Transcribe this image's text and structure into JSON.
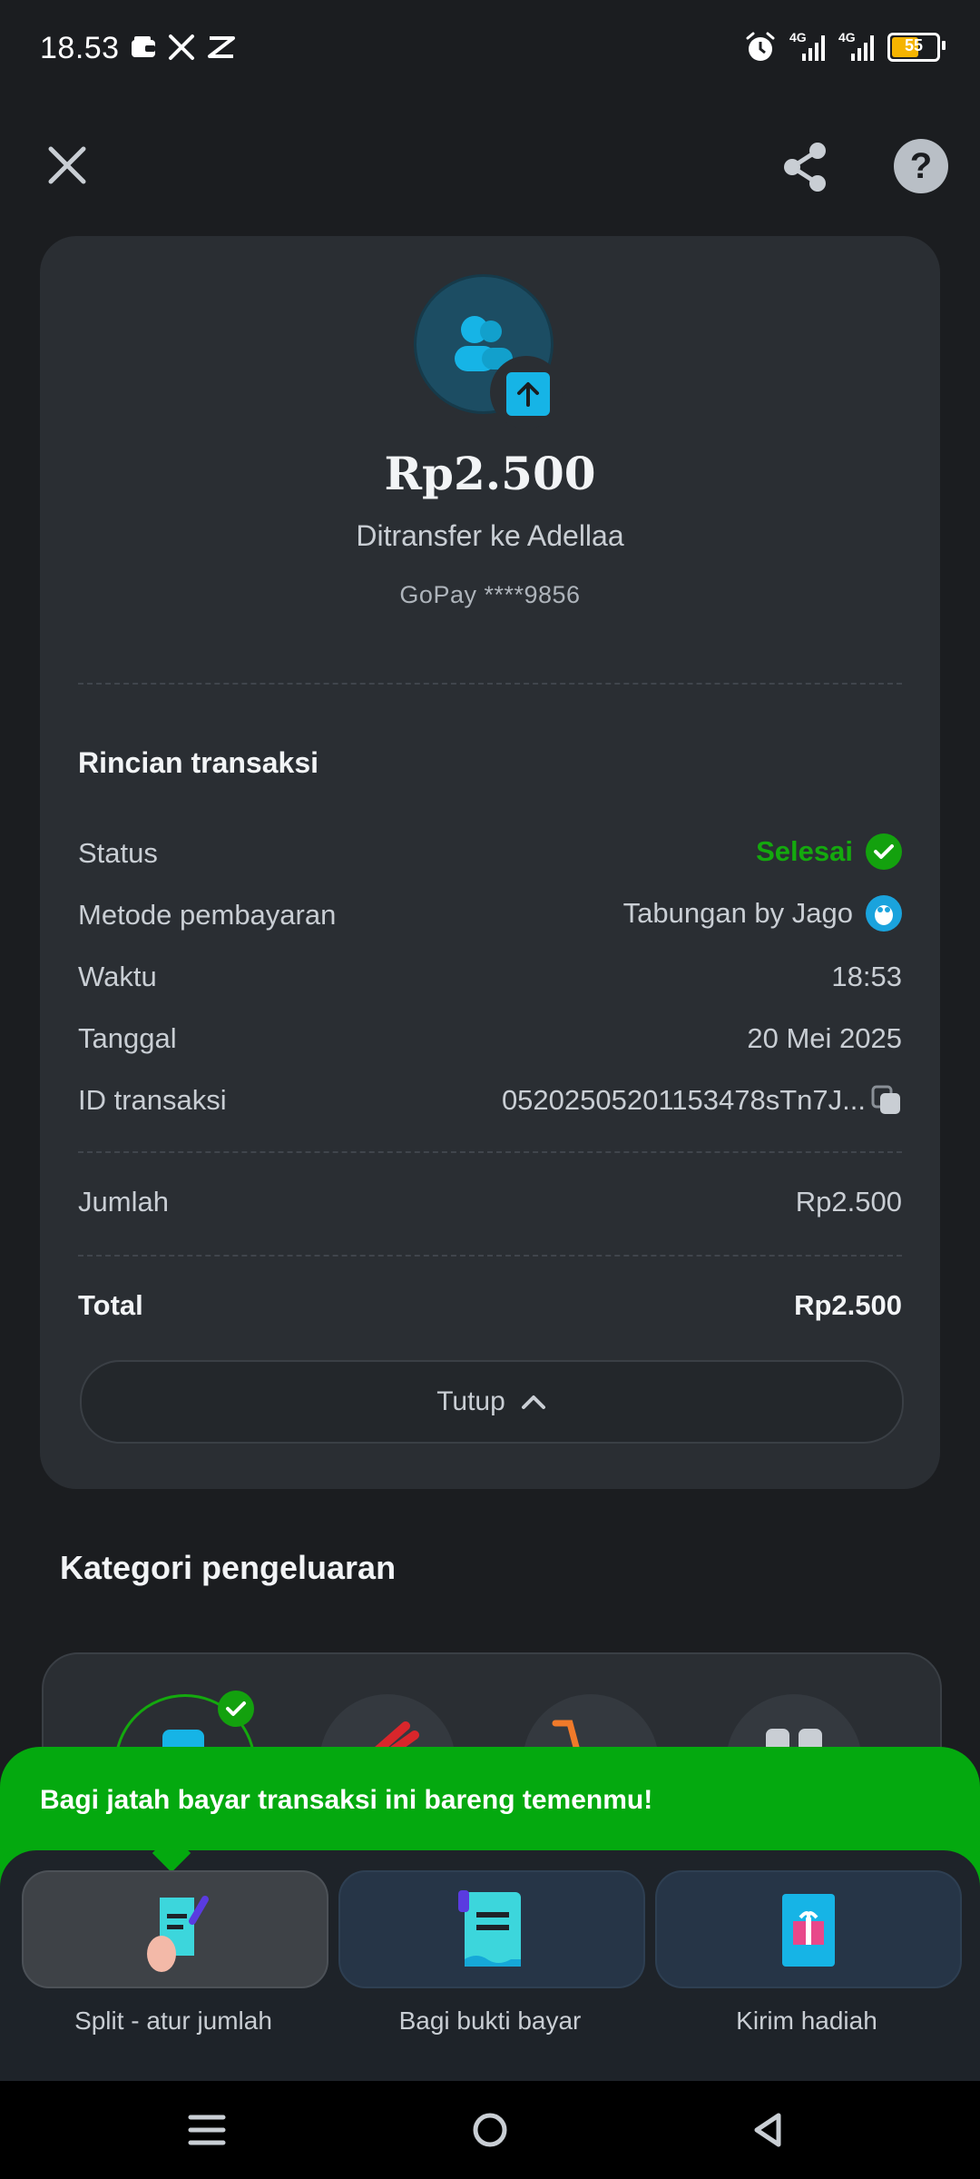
{
  "status_bar": {
    "time": "18.53",
    "left_icons": [
      "wallet-icon",
      "x-icon",
      "capcut-icon"
    ],
    "right_icons": [
      "alarm-icon",
      "signal-4g-icon",
      "signal-4g-icon",
      "battery-icon"
    ],
    "network_1": "4G",
    "network_2": "4G",
    "battery": "55"
  },
  "header": {
    "close_icon": "close-icon",
    "share_icon": "share-icon",
    "help_label": "?"
  },
  "transaction": {
    "amount": "Rp2.500",
    "subtitle": "Ditransfer ke Adellaa",
    "account": "GoPay ****9856"
  },
  "details": {
    "title": "Rincian transaksi",
    "rows": [
      {
        "label": "Status",
        "value": "Selesai"
      },
      {
        "label": "Metode pembayaran",
        "value": "Tabungan by Jago"
      },
      {
        "label": "Waktu",
        "value": "18:53"
      },
      {
        "label": "Tanggal",
        "value": "20 Mei 2025"
      },
      {
        "label": "ID transaksi",
        "value": "05202505201153478sTn7J..."
      }
    ],
    "amount_label": "Jumlah",
    "amount_value": "Rp2.500",
    "total_label": "Total",
    "total_value": "Rp2.500",
    "close_button": "Tutup"
  },
  "category": {
    "title": "Kategori pengeluaran"
  },
  "split_sheet": {
    "banner": "Bagi jatah bayar transaksi ini bareng temenmu!",
    "options": [
      {
        "label": "Split - atur jumlah",
        "icon": "split-receipt-icon"
      },
      {
        "label": "Bagi bukti bayar",
        "icon": "receipt-icon"
      },
      {
        "label": "Kirim hadiah",
        "icon": "gift-icon"
      }
    ]
  },
  "colors": {
    "success": "#14a90e",
    "banner": "#04a90f",
    "accent_blue": "#16b4e6"
  }
}
